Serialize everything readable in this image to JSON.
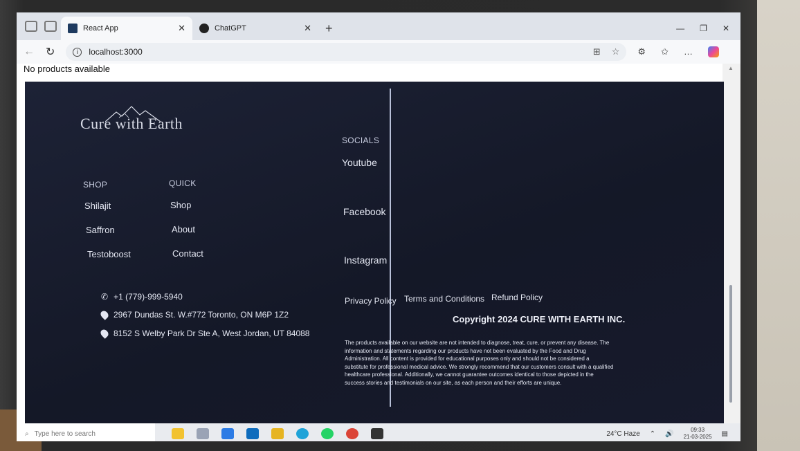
{
  "browser": {
    "tabs": [
      {
        "label": "React App",
        "active": true
      },
      {
        "label": "ChatGPT",
        "active": false
      }
    ],
    "address": "localhost:3000",
    "icons": [
      "back-icon",
      "refresh-icon",
      "site-info-icon",
      "split-screen-icon",
      "favorite-icon",
      "extensions-icon",
      "collections-icon",
      "more-icon",
      "copilot-icon"
    ]
  },
  "page": {
    "status_text": "No products available"
  },
  "footer": {
    "logo": "Cure with Earth",
    "shop": {
      "heading": "SHOP",
      "links": [
        "Shilajit",
        "Saffron",
        "Testoboost"
      ]
    },
    "quick": {
      "heading": "QUICK",
      "links": [
        "Shop",
        "About",
        "Contact"
      ]
    },
    "socials": {
      "heading": "SOCIALS",
      "links": [
        "Youtube",
        "Facebook",
        "Instagram"
      ]
    },
    "contact": {
      "phone": "+1 (779)-999-5940",
      "address1": "2967 Dundas St. W.#772 Toronto, ON M6P 1Z2",
      "address2": "8152 S Welby Park Dr Ste A, West Jordan, UT 84088"
    },
    "policies": [
      "Privacy Policy",
      "Terms and Conditions",
      "Refund Policy"
    ],
    "copyright": "Copyright 2024 CURE WITH EARTH INC.",
    "disclaimer": "The products available on our website are not intended to diagnose, treat, cure, or prevent any disease. The information and statements regarding our products have not been evaluated by the Food and Drug Administration. All content is provided for educational purposes only and should not be considered a substitute for professional medical advice. We strongly recommend that our customers consult with a qualified healthcare professional. Additionally, we cannot guarantee outcomes identical to those depicted in the success stories and testimonials on our site, as each person and their efforts are unique."
  },
  "taskbar": {
    "search_placeholder": "Type here to search",
    "weather": "24°C  Haze",
    "time": "09:33",
    "date": "21-03-2025"
  }
}
